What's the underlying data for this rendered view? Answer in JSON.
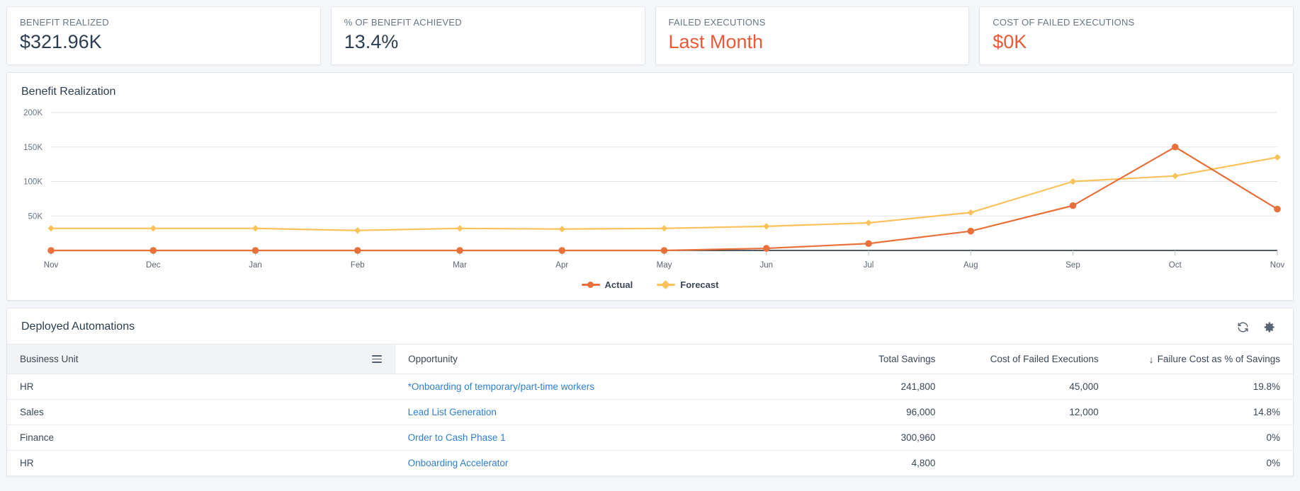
{
  "kpis": [
    {
      "label": "BENEFIT REALIZED",
      "value": "$321.96K",
      "tone": "normal"
    },
    {
      "label": "% OF BENEFIT ACHIEVED",
      "value": "13.4%",
      "tone": "normal"
    },
    {
      "label": "FAILED EXECUTIONS",
      "value": "Last Month",
      "tone": "danger"
    },
    {
      "label": "COST OF FAILED EXECUTIONS",
      "value": "$0K",
      "tone": "danger"
    }
  ],
  "chart_panel": {
    "title": "Benefit Realization"
  },
  "chart_data": {
    "type": "line",
    "title": "Benefit Realization",
    "xlabel": "",
    "ylabel": "",
    "ylim": [
      0,
      200000
    ],
    "yticks": [
      50000,
      100000,
      150000,
      200000
    ],
    "ytick_labels": [
      "50K",
      "100K",
      "150K",
      "200K"
    ],
    "grid": true,
    "legend_position": "bottom",
    "categories": [
      "Nov",
      "Dec",
      "Jan",
      "Feb",
      "Mar",
      "Apr",
      "May",
      "Jun",
      "Jul",
      "Aug",
      "Sep",
      "Oct",
      "Nov"
    ],
    "series": [
      {
        "name": "Actual",
        "color": "#e8703a",
        "marker": "circle",
        "values": [
          0,
          0,
          0,
          0,
          0,
          0,
          0,
          3000,
          10000,
          28000,
          65000,
          150000,
          60000
        ]
      },
      {
        "name": "Forecast",
        "color": "#fbc25b",
        "marker": "diamond",
        "values": [
          32000,
          32000,
          32000,
          29000,
          32000,
          31000,
          32000,
          35000,
          40000,
          55000,
          100000,
          108000,
          135000
        ]
      }
    ]
  },
  "table_panel": {
    "title": "Deployed Automations",
    "refresh_icon": "refresh-icon",
    "settings_icon": "gear-icon",
    "columns": [
      {
        "key": "business_unit",
        "label": "Business Unit",
        "align": "left",
        "selected": true,
        "menu_icon": "hamburger-icon"
      },
      {
        "key": "opportunity",
        "label": "Opportunity",
        "align": "left",
        "selected": false
      },
      {
        "key": "total_savings",
        "label": "Total Savings",
        "align": "right",
        "selected": false
      },
      {
        "key": "cost_of_failed_executions",
        "label": "Cost of Failed Executions",
        "align": "right",
        "selected": false
      },
      {
        "key": "failure_cost_pct",
        "label": "Failure Cost as % of Savings",
        "align": "right",
        "selected": false,
        "sort": "desc",
        "sort_glyph": "↓"
      }
    ],
    "rows": [
      {
        "business_unit": "HR",
        "opportunity": "*Onboarding of temporary/part-time workers",
        "total_savings": "241,800",
        "cost_of_failed_executions": "45,000",
        "failure_cost_pct": "19.8%"
      },
      {
        "business_unit": "Sales",
        "opportunity": "Lead List Generation",
        "total_savings": "96,000",
        "cost_of_failed_executions": "12,000",
        "failure_cost_pct": "14.8%"
      },
      {
        "business_unit": "Finance",
        "opportunity": "Order to Cash Phase 1",
        "total_savings": "300,960",
        "cost_of_failed_executions": "",
        "failure_cost_pct": "0%"
      },
      {
        "business_unit": "HR",
        "opportunity": "Onboarding Accelerator",
        "total_savings": "4,800",
        "cost_of_failed_executions": "",
        "failure_cost_pct": "0%"
      }
    ]
  },
  "colors": {
    "actual": "#e8703a",
    "forecast": "#fbc25b",
    "danger": "#e8593a",
    "link": "#2f7fd1",
    "page_bg": "#f4f6f9"
  }
}
